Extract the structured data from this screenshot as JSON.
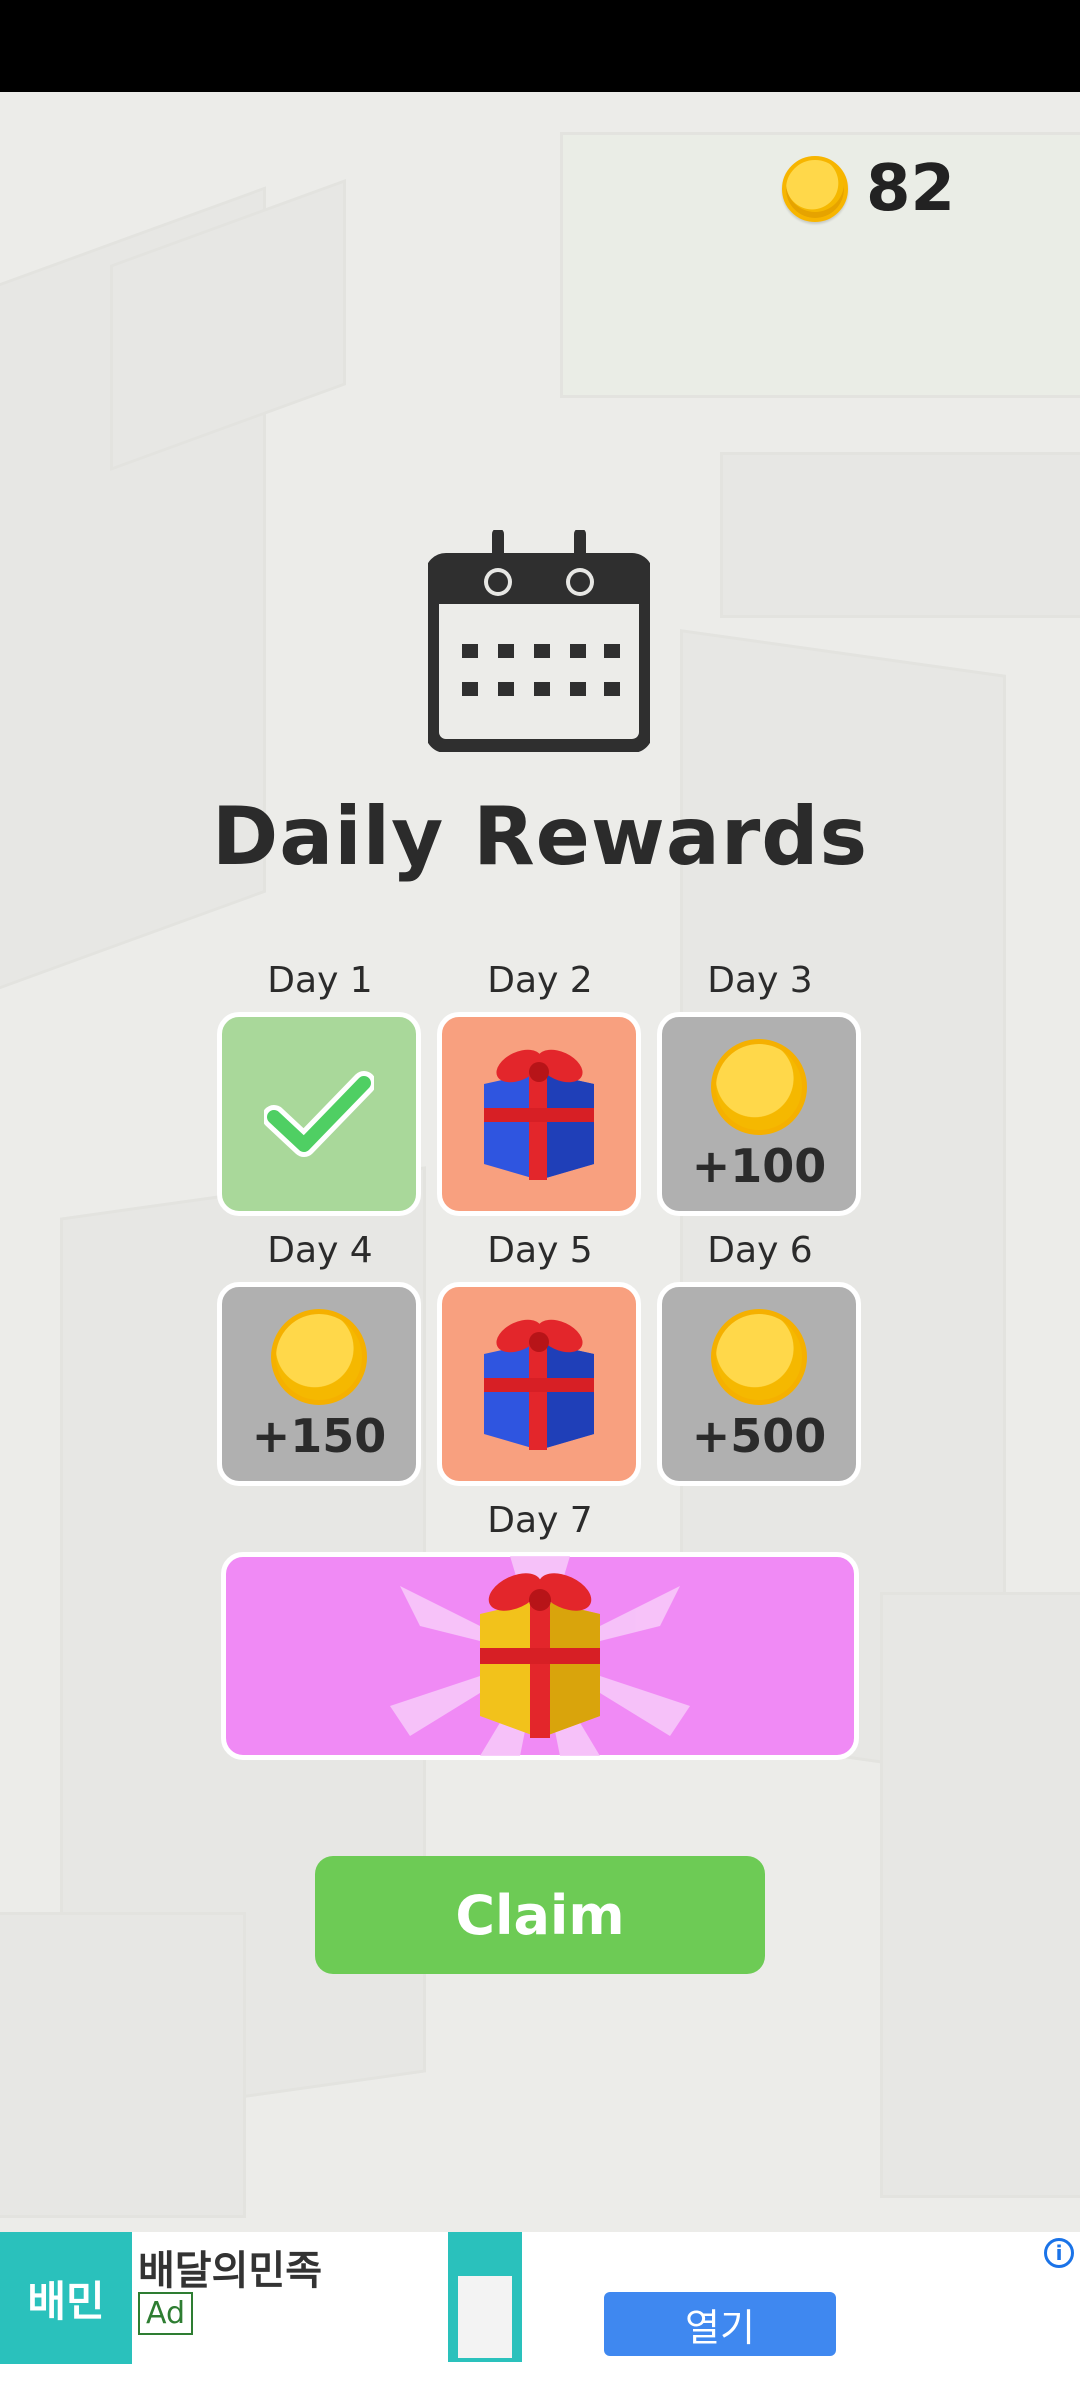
{
  "coins": {
    "value": "82"
  },
  "title": "Daily Rewards",
  "days": [
    {
      "label": "Day 1",
      "state": "claimed"
    },
    {
      "label": "Day 2",
      "reward": "gift"
    },
    {
      "label": "Day 3",
      "reward": "coins",
      "amount": "+100"
    },
    {
      "label": "Day 4",
      "reward": "coins",
      "amount": "+150"
    },
    {
      "label": "Day 5",
      "reward": "gift"
    },
    {
      "label": "Day 6",
      "reward": "coins",
      "amount": "+500"
    },
    {
      "label": "Day 7",
      "reward": "golden-gift"
    }
  ],
  "claim_label": "Claim",
  "ad": {
    "logo_text": "배민",
    "name": "배달의민족",
    "badge": "Ad",
    "open_label": "열기",
    "info": "i"
  },
  "colors": {
    "claimed": "#a9d89a",
    "gift": "#f8a07f",
    "coins": "#b0b0b0",
    "day7": "#f08af5",
    "claim": "#6dcb55"
  }
}
